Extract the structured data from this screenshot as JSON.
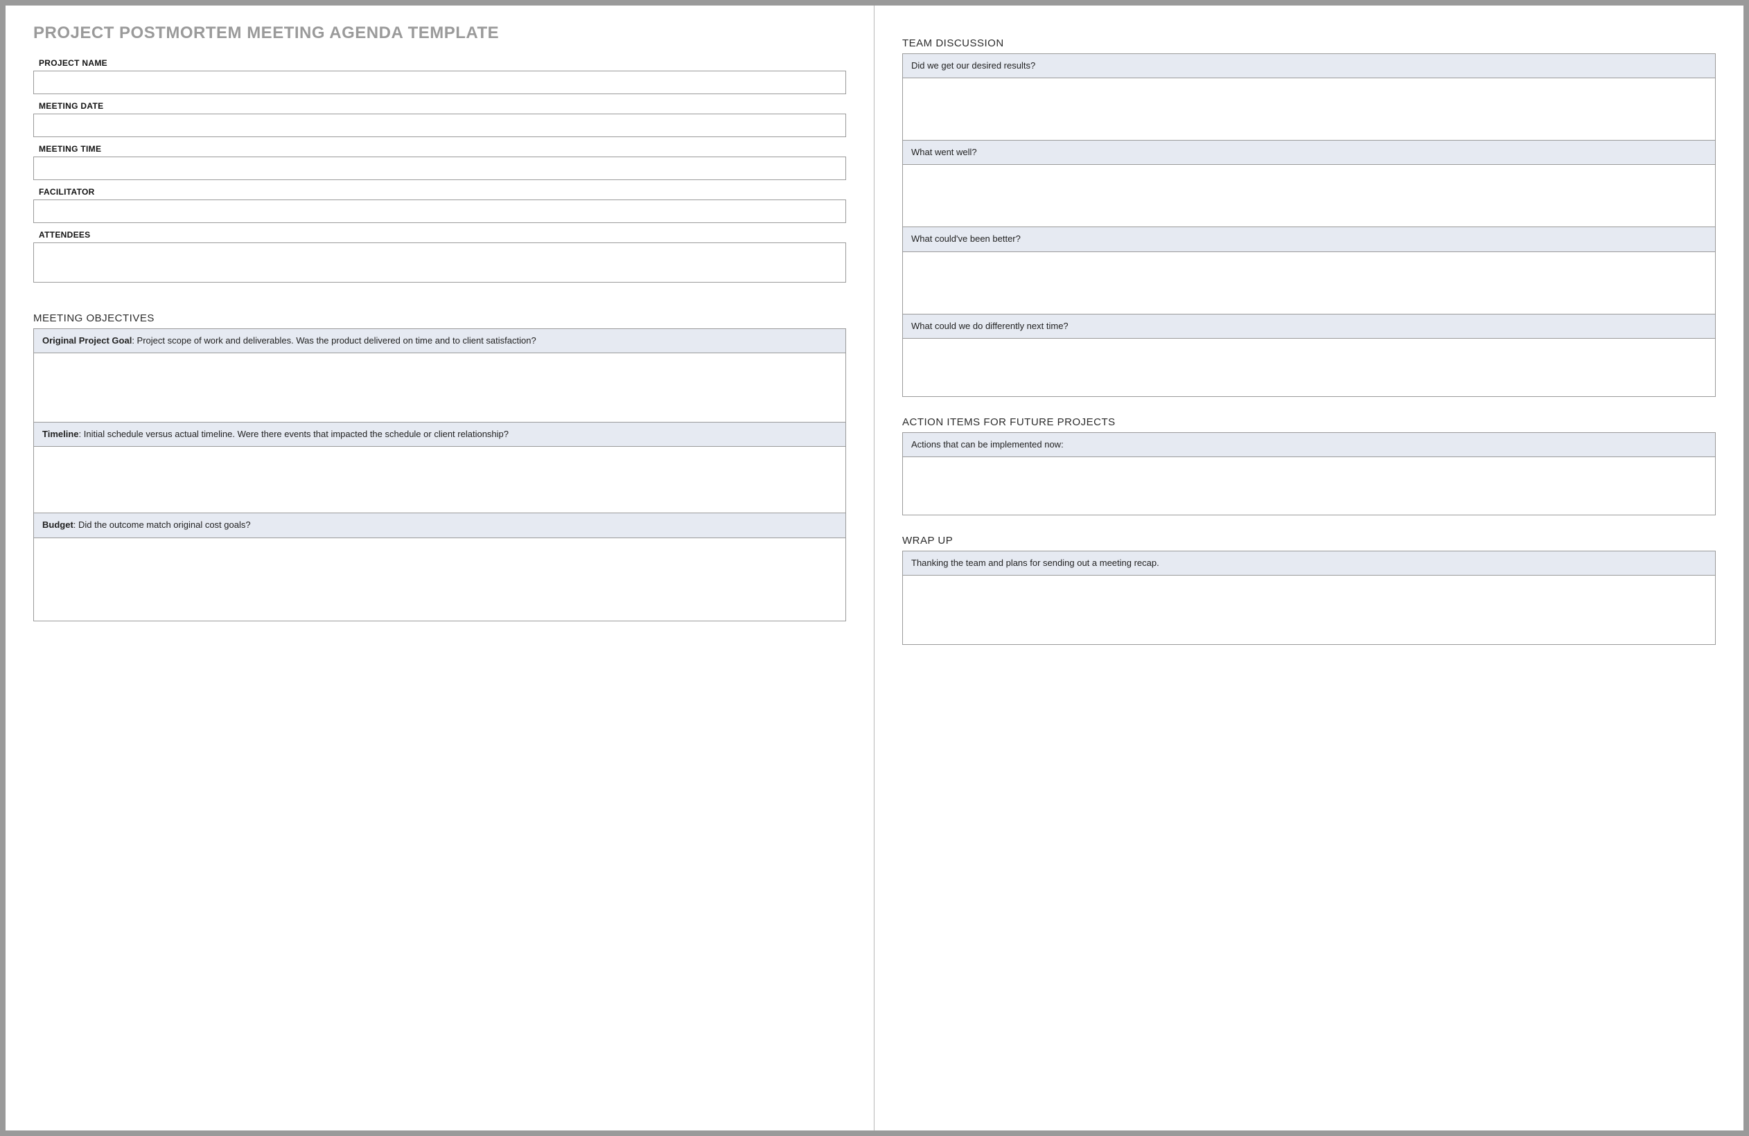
{
  "title": "PROJECT POSTMORTEM MEETING AGENDA TEMPLATE",
  "fields": {
    "project_name": {
      "label": "PROJECT NAME",
      "value": ""
    },
    "meeting_date": {
      "label": "MEETING DATE",
      "value": ""
    },
    "meeting_time": {
      "label": "MEETING TIME",
      "value": ""
    },
    "facilitator": {
      "label": "FACILITATOR",
      "value": ""
    },
    "attendees": {
      "label": "ATTENDEES",
      "value": ""
    }
  },
  "objectives": {
    "heading": "MEETING OBJECTIVES",
    "items": [
      {
        "bold": "Original Project Goal",
        "text": ": Project scope of work and deliverables. Was the product delivered on time and to client satisfaction?",
        "value": ""
      },
      {
        "bold": "Timeline",
        "text": ": Initial schedule versus actual timeline. Were there events that impacted the schedule or client relationship?",
        "value": ""
      },
      {
        "bold": "Budget",
        "text": ": Did the outcome match original cost goals?",
        "value": ""
      }
    ]
  },
  "discussion": {
    "heading": "TEAM DISCUSSION",
    "items": [
      {
        "prompt": "Did we get our desired results?",
        "value": ""
      },
      {
        "prompt": "What went well?",
        "value": ""
      },
      {
        "prompt": "What could've been better?",
        "value": ""
      },
      {
        "prompt": "What could we do differently next time?",
        "value": ""
      }
    ]
  },
  "action_items": {
    "heading": "ACTION ITEMS FOR FUTURE PROJECTS",
    "prompt": "Actions that can be implemented now:",
    "value": ""
  },
  "wrap_up": {
    "heading": "WRAP UP",
    "prompt": "Thanking the team and plans for sending out a meeting recap.",
    "value": ""
  }
}
